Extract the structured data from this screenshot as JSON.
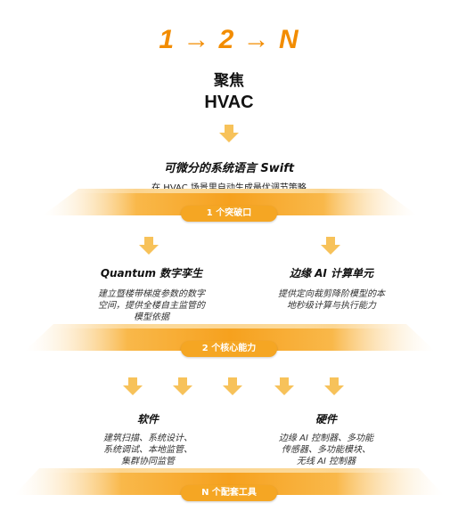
{
  "headline": "1 → 2 → N",
  "focus": {
    "line1": "聚焦",
    "line2": "HVAC"
  },
  "tier1": {
    "title": "可微分的系统语言 Swift",
    "subtitle": "在 HVAC 场景里自动生成最优调节策略",
    "label": "1 个突破口"
  },
  "tier2": {
    "left": {
      "title": "Quantum 数字孪生",
      "lines": [
        "建立暨楼带梯度参数的数字",
        "空间，提供全楼自主监管的",
        "模型依据"
      ]
    },
    "right": {
      "title": "边缘 AI 计算单元",
      "lines": [
        "提供定向裁剪降阶模型的本",
        "地秒级计算与执行能力"
      ]
    },
    "label": "2 个核心能力"
  },
  "tier3": {
    "left": {
      "title": "软件",
      "lines": [
        "建筑扫描、系统设计、",
        "系统调试、本地监管、",
        "集群协同监管"
      ]
    },
    "right": {
      "title": "硬件",
      "lines": [
        "边缘 AI 控制器、多功能",
        "传感器、多功能模块、",
        "无线 AI 控制器"
      ]
    },
    "label": "N 个配套工具"
  },
  "colors": {
    "accent": "#F28C00",
    "band": "#F7A21B",
    "arrow": "#F7C25A"
  }
}
